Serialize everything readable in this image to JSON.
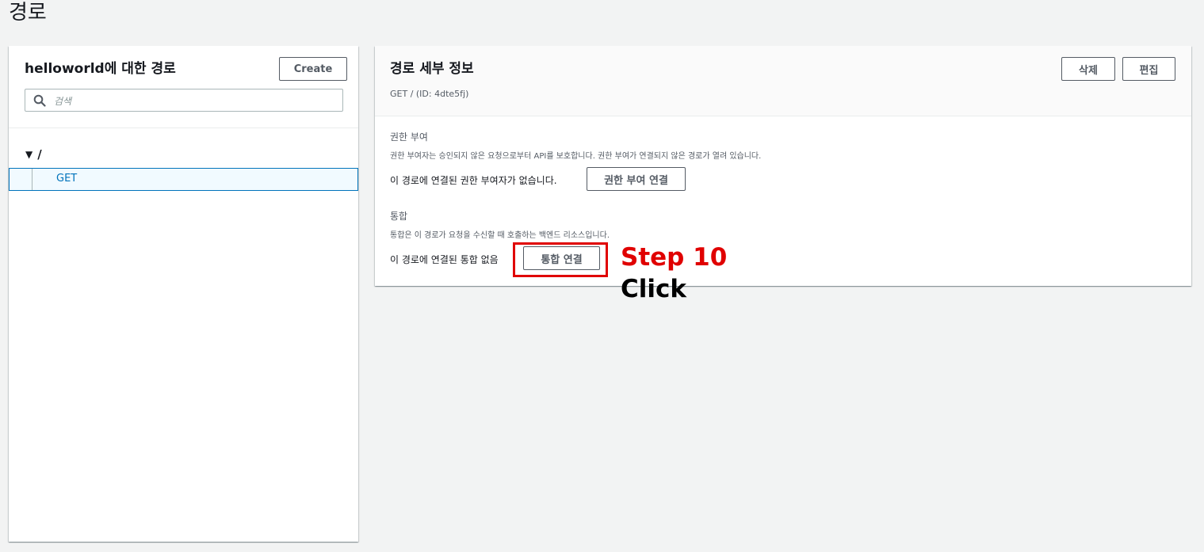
{
  "page": {
    "title": "경로"
  },
  "left_panel": {
    "title": "helloworld에 대한 경로",
    "create_label": "Create",
    "search_placeholder": "검색",
    "tree": {
      "root_caret": "▼",
      "root_label": "/",
      "items": [
        {
          "label": "GET",
          "selected": true
        }
      ]
    }
  },
  "right_panel": {
    "title": "경로 세부 정보",
    "subtitle": "GET / (ID: 4dte5fj)",
    "delete_label": "삭제",
    "edit_label": "편집",
    "authorization": {
      "label": "권한 부여",
      "description": "권한 부여자는 승인되지 않은 요청으로부터 API를 보호합니다. 권한 부여가 연결되지 않은 경로가 열려 있습니다.",
      "status_text": "이 경로에 연결된 권한 부여자가 없습니다.",
      "button_label": "권한 부여 연결"
    },
    "integration": {
      "label": "통합",
      "description": "통합은 이 경로가 요청을 수신할 때 호출하는 백엔드 리소스입니다.",
      "status_text": "이 경로에 연결된 통합 없음",
      "button_label": "통합 연결"
    }
  },
  "annotation": {
    "step_label": "Step 10",
    "action_label": "Click",
    "color": "#e00000"
  },
  "colors": {
    "background": "#f2f3f3",
    "link_blue": "#0073bb",
    "selected_bg": "#f1faff",
    "button_border": "#545b64"
  },
  "icons": {
    "search": "search-icon",
    "caret": "caret-down-icon"
  }
}
